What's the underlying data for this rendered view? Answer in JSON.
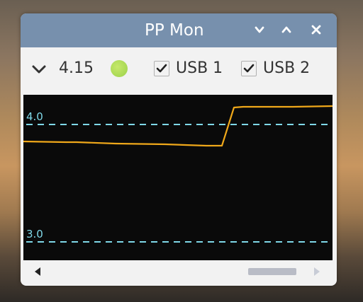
{
  "window": {
    "title": "PP Mon"
  },
  "titlebar": {
    "buttons": [
      {
        "name": "minimize",
        "icon": "chevron-down-icon"
      },
      {
        "name": "maximize",
        "icon": "chevron-up-icon"
      },
      {
        "name": "close",
        "icon": "close-icon"
      }
    ]
  },
  "toolbar": {
    "voltage_value": "4.15",
    "status_color": "#9bd24a",
    "usb1": {
      "label": "USB 1",
      "checked": true
    },
    "usb2": {
      "label": "USB 2",
      "checked": true
    }
  },
  "plot": {
    "reference_lines": [
      {
        "label": "4.0",
        "value": 4.0,
        "color": "#7fd8e8"
      },
      {
        "label": "3.0",
        "value": 3.0,
        "color": "#7fd8e8"
      }
    ],
    "trace_color": "#f0a81a",
    "background": "#0a0a0a"
  },
  "colors": {
    "titlebar": "#7790ad",
    "window_bg": "#f2f2f2"
  }
}
